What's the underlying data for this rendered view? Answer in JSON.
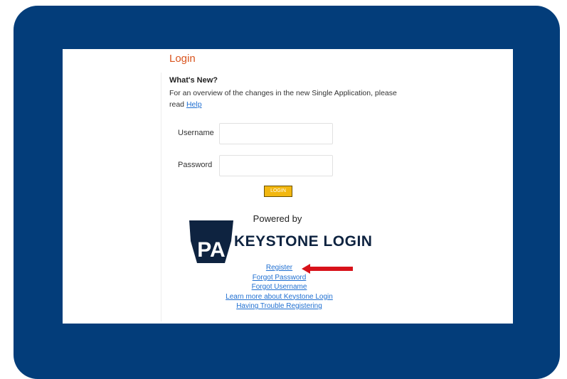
{
  "page": {
    "title": "Login"
  },
  "whats_new": {
    "heading": "What's New?",
    "text": "For an overview of the changes in the new Single Application, please read",
    "help_link": "Help"
  },
  "form": {
    "username_label": "Username",
    "username_value": "",
    "password_label": "Password",
    "password_value": "",
    "login_button": "LOGIN"
  },
  "branding": {
    "powered_by": "Powered by",
    "logo_text": "PA",
    "name": "KEYSTONE LOGIN"
  },
  "links": [
    "Register",
    "Forgot Password",
    "Forgot Username",
    "Learn more about Keystone Login",
    "Having Trouble Registering"
  ],
  "colors": {
    "frame": "#033d7a",
    "title": "#d9541e",
    "link": "#1f6fd1",
    "button": "#f2b710",
    "logo": "#0e2340",
    "arrow": "#d8121a"
  },
  "icons": {
    "pointer": "red-arrow-icon"
  }
}
